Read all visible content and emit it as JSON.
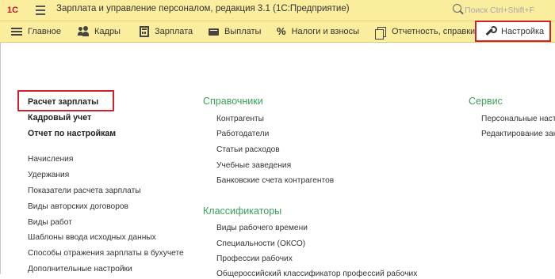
{
  "titlebar": {
    "logo_text": "1С",
    "title": "Зарплата и управление персоналом, редакция 3.1  (1С:Предприятие)",
    "search_placeholder": "Поиск Ctrl+Shift+F"
  },
  "sections": [
    {
      "label": "Главное",
      "icon": "menu-lines-icon"
    },
    {
      "label": "Кадры",
      "icon": "people-icon"
    },
    {
      "label": "Зарплата",
      "icon": "calculator-icon"
    },
    {
      "label": "Выплаты",
      "icon": "wallet-icon"
    },
    {
      "label": "Налоги и взносы",
      "icon": "percent-icon"
    },
    {
      "label": "Отчетность, справки",
      "icon": "reports-icon"
    },
    {
      "label": "Настройка",
      "icon": "wrench-icon",
      "active": true
    }
  ],
  "left_column": {
    "bold_items": [
      "Расчет зарплаты",
      "Кадровый учет",
      "Отчет по настройкам"
    ],
    "items": [
      "Начисления",
      "Удержания",
      "Показатели расчета зарплаты",
      "Виды авторских договоров",
      "Виды работ",
      "Шаблоны ввода исходных данных",
      "Способы отражения зарплаты в бухучете",
      "Дополнительные настройки"
    ]
  },
  "middle_column": {
    "group1_title": "Справочники",
    "group1_items": [
      "Контрагенты",
      "Работодатели",
      "Статьи расходов",
      "Учебные заведения",
      "Банковские счета контрагентов"
    ],
    "group2_title": "Классификаторы",
    "group2_items": [
      "Виды рабочего времени",
      "Специальности (ОКСО)",
      "Профессии рабочих",
      "Общероссийский классификатор профессий рабочих"
    ]
  },
  "right_column": {
    "group_title": "Сервис",
    "items": [
      "Персональные настройки",
      "Редактирование закладок"
    ]
  },
  "colors": {
    "bar_background": "#fbed9e",
    "group_title": "#3aa05a",
    "highlight": "#d0202c"
  }
}
